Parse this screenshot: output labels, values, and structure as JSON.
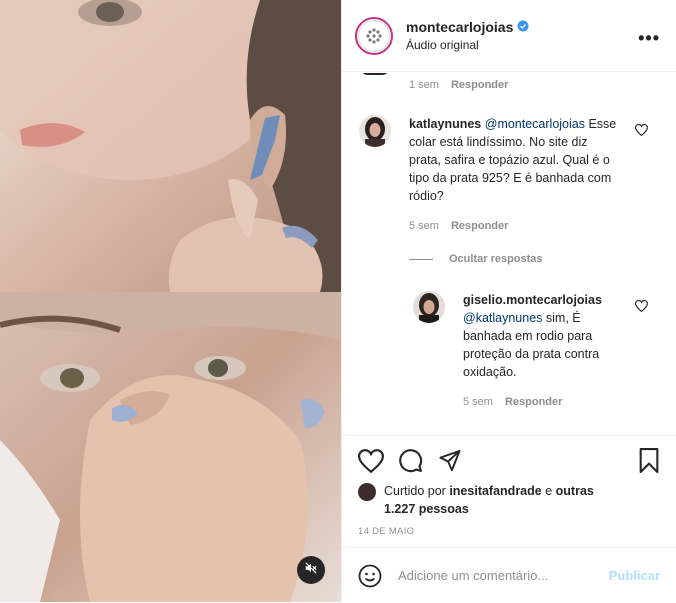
{
  "header": {
    "username": "montecarlojoias",
    "subtitle": "Áudio original",
    "more_label": "•••"
  },
  "comments": {
    "top_meta": {
      "time": "1 sem",
      "reply": "Responder"
    },
    "first": {
      "user": "katlaynunes",
      "mention": "@montecarlojoias",
      "text": "Esse colar está lindíssimo. No site diz prata, safira e topázio azul. Qual é o tipo da prata 925? E é banhada com ródio?",
      "time": "5 sem",
      "reply": "Responder"
    },
    "hide_replies": "Ocultar respostas",
    "reply": {
      "user": "giselio.montecarlojoias",
      "mention": "@katlaynunes",
      "text": "sim, É banhada em rodio para proteção da prata contra oxidação.",
      "time": "5 sem",
      "reply": "Responder"
    }
  },
  "likes": {
    "prefix": "Curtido por",
    "user": "inesitafandrade",
    "middle": "e",
    "others": "outras 1.227 pessoas"
  },
  "date": "14 DE MAIO",
  "comment_box": {
    "placeholder": "Adicione um comentário...",
    "publish": "Publicar"
  },
  "colors": {
    "link": "#00376b",
    "muted": "#8e8e8e",
    "publish": "#b2dffc",
    "verified": "#3897f0"
  }
}
